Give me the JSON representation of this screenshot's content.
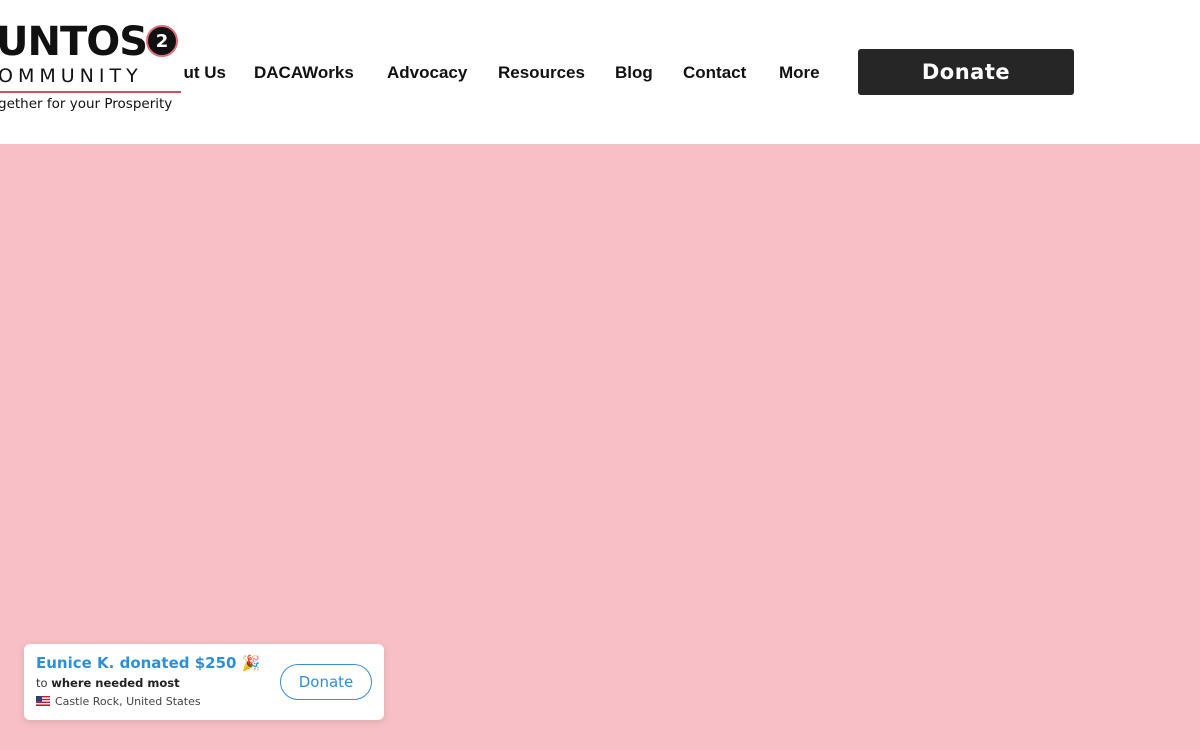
{
  "logo": {
    "word": "UNTOS",
    "badge": "2",
    "community": "OMMUNITY",
    "tagline": "gether for your Prosperity"
  },
  "nav": {
    "items": [
      {
        "label": "ut Us"
      },
      {
        "label": "DACAWorks"
      },
      {
        "label": "Advocacy"
      },
      {
        "label": "Resources"
      },
      {
        "label": "Blog"
      },
      {
        "label": "Contact"
      },
      {
        "label": "More"
      }
    ]
  },
  "header_donate": {
    "label": "Donate"
  },
  "colors": {
    "hero_background": "#f8c0c6",
    "donate_button": "#262626",
    "toast_accent": "#2e8fd8",
    "logo_accent": "#d0505c"
  },
  "toast": {
    "title": "Eunice K. donated $250 🎉",
    "prefix": "to",
    "target": "where needed most",
    "location": "Castle Rock, United States",
    "flag_icon": "us-flag-icon",
    "button_label": "Donate"
  }
}
